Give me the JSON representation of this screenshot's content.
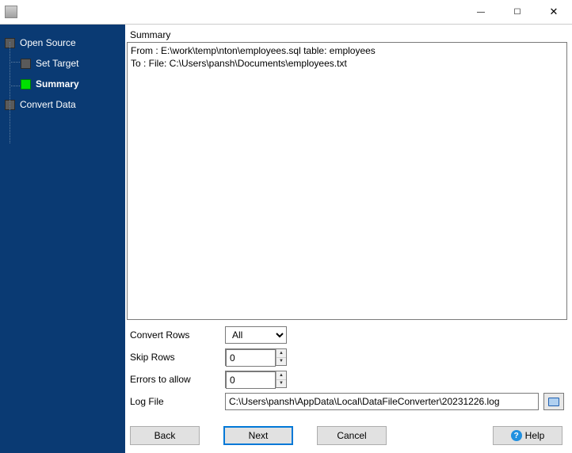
{
  "window": {
    "title": ""
  },
  "sidebar": {
    "steps": [
      {
        "label": "Open Source",
        "active": false,
        "sub": false
      },
      {
        "label": "Set Target",
        "active": false,
        "sub": true
      },
      {
        "label": "Summary",
        "active": true,
        "sub": true
      },
      {
        "label": "Convert Data",
        "active": false,
        "sub": false
      }
    ]
  },
  "main": {
    "summary_label": "Summary",
    "summary_text": "From : E:\\work\\temp\\nton\\employees.sql table: employees\nTo : File: C:\\Users\\pansh\\Documents\\employees.txt"
  },
  "settings": {
    "convert_rows": {
      "label": "Convert Rows",
      "value": "All",
      "options": [
        "All"
      ]
    },
    "skip_rows": {
      "label": "Skip Rows",
      "value": "0"
    },
    "errors_allow": {
      "label": "Errors to allow",
      "value": "0"
    },
    "log_file": {
      "label": "Log File",
      "value": "C:\\Users\\pansh\\AppData\\Local\\DataFileConverter\\20231226.log"
    }
  },
  "buttons": {
    "back": "Back",
    "next": "Next",
    "cancel": "Cancel",
    "help": "Help"
  }
}
